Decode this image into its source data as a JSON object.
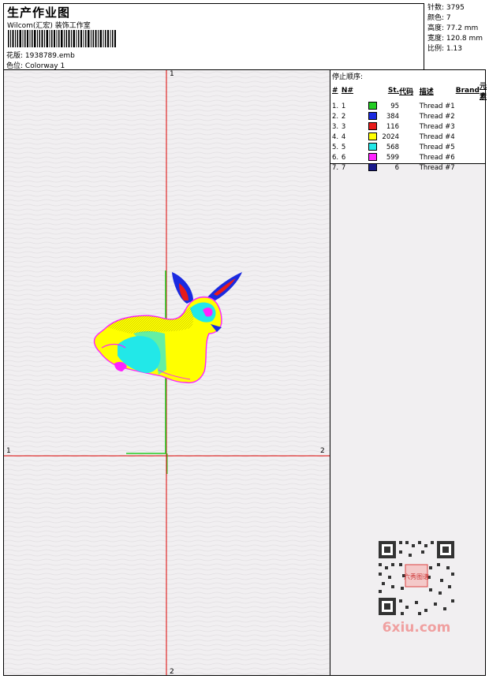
{
  "header": {
    "title": "生产作业图",
    "studio": "Wilcom(汇宏) 装饰工作室",
    "design_label": "花版:",
    "design_file": "1938789.emb",
    "colorway_label": "色位:",
    "colorway": "Colorway 1"
  },
  "stats": {
    "stitches": "针数: 3795",
    "colors": "颜色: 7",
    "height": "高度: 77.2 mm",
    "width": "宽度: 120.8 mm",
    "scale": "比例: 1.13"
  },
  "thread_panel": {
    "stop_sequence_label": "停止顺序:",
    "columns": {
      "num": "#",
      "needle": "N#",
      "stitches": "St.",
      "code": "代码",
      "description": "描述",
      "brand": "Brand",
      "element": "元素"
    },
    "rows": [
      {
        "num": "1.",
        "needle": "1",
        "color": "#22cc22",
        "stitches": "95",
        "description": "Thread #1"
      },
      {
        "num": "2.",
        "needle": "2",
        "color": "#1a2ae0",
        "stitches": "384",
        "description": "Thread #2"
      },
      {
        "num": "3.",
        "needle": "3",
        "color": "#e81b1b",
        "stitches": "116",
        "description": "Thread #3"
      },
      {
        "num": "4.",
        "needle": "4",
        "color": "#ffff00",
        "stitches": "2024",
        "description": "Thread #4"
      },
      {
        "num": "5.",
        "needle": "5",
        "color": "#22e8e8",
        "stitches": "568",
        "description": "Thread #5"
      },
      {
        "num": "6.",
        "needle": "6",
        "color": "#ff22ff",
        "stitches": "599",
        "description": "Thread #6"
      },
      {
        "num": "7.",
        "needle": "7",
        "color": "#1a1a8c",
        "stitches": "6",
        "description": "Thread #7"
      }
    ]
  },
  "axes": {
    "vertical_top": "1",
    "vertical_bottom": "2",
    "horizontal_left": "1",
    "horizontal_right": "2",
    "axis_color": "#dd0000"
  },
  "watermark": {
    "site": "6xiu.com",
    "seal": "六秀图谱"
  },
  "colors": {
    "page_background": "#f1eff1",
    "accent_red": "#dd0000"
  }
}
